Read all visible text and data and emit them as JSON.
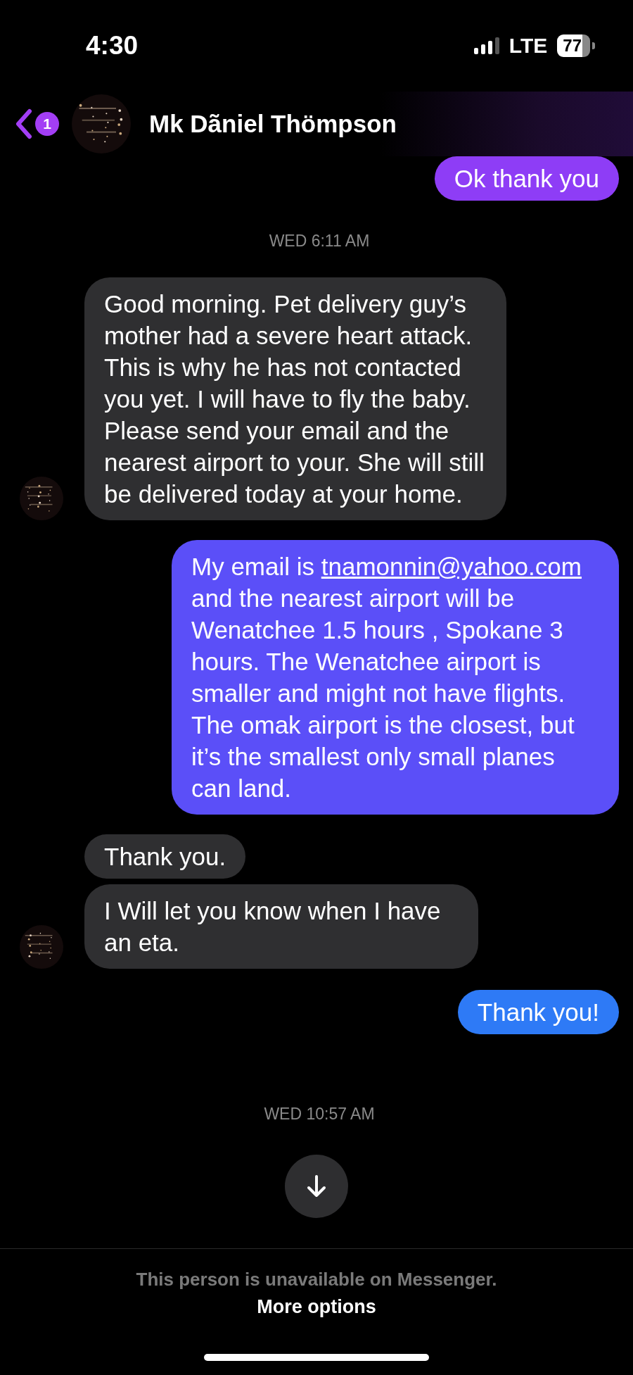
{
  "status_bar": {
    "time": "4:30",
    "network": "LTE",
    "battery": "77"
  },
  "header": {
    "back_badge": "1",
    "name": "Mk Dãniel Thömpson"
  },
  "messages": [
    {
      "kind": "outgoing",
      "color": "#8e3df6",
      "parts": [
        {
          "text": "Ok thank you"
        }
      ]
    },
    {
      "kind": "timestamp",
      "text": "WED 6:11 AM"
    },
    {
      "kind": "incoming",
      "avatar": true,
      "parts": [
        {
          "text": "Good morning. Pet delivery guy’s mother had a severe heart attack. This is why he has not contacted you yet. I will have to fly the baby. Please send your email and the nearest airport to your. She will still be delivered today at your home."
        }
      ]
    },
    {
      "kind": "outgoing",
      "color": "#5b4ff8",
      "parts": [
        {
          "text": "My email is "
        },
        {
          "text": "tnamonnin@yahoo.com",
          "kind": "link"
        },
        {
          "text": " and the nearest airport will be Wenatchee 1.5 hours , Spokane 3 hours. The Wenatchee airport is smaller and might not have flights. The omak airport is the closest, but it’s the smallest only small planes can land."
        }
      ]
    },
    {
      "kind": "incoming",
      "avatar": false,
      "parts": [
        {
          "text": "Thank you."
        }
      ]
    },
    {
      "kind": "incoming",
      "avatar": true,
      "parts": [
        {
          "text": "I Will let you know when I have an eta."
        }
      ]
    },
    {
      "kind": "outgoing",
      "color": "#2e7af6",
      "parts": [
        {
          "text": "Thank you!"
        }
      ]
    },
    {
      "kind": "timestamp",
      "text": "WED 10:57 AM"
    }
  ],
  "footer": {
    "notice": "This person is unavailable on Messenger.",
    "action": "More options"
  }
}
